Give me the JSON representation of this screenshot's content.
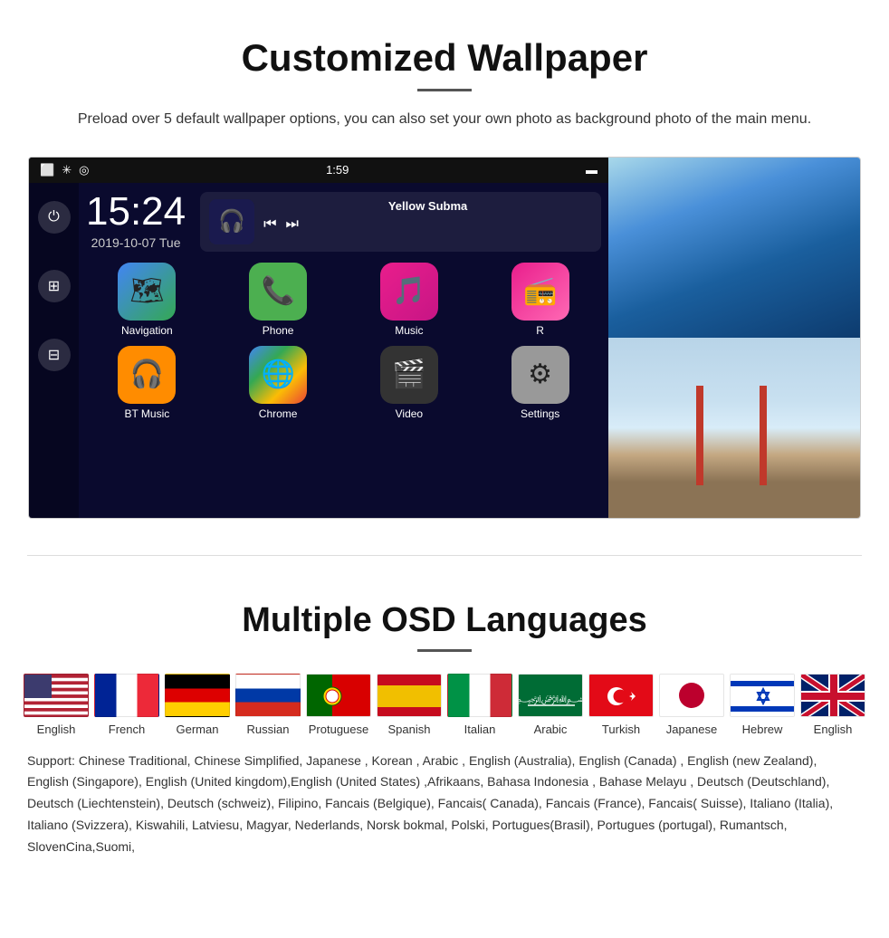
{
  "wallpaper_section": {
    "title": "Customized Wallpaper",
    "description": "Preload over 5 default wallpaper options, you can also set your own photo as background photo of the main menu.",
    "screen": {
      "time": "1:59",
      "clock": "15:24",
      "date": "2019-10-07  Tue",
      "music_title": "Yellow Subma",
      "apps": [
        {
          "label": "Navigation",
          "icon": "🗺"
        },
        {
          "label": "Phone",
          "icon": "📞"
        },
        {
          "label": "Music",
          "icon": "🎵"
        },
        {
          "label": "R",
          "icon": "📻"
        },
        {
          "label": "BT Music",
          "icon": "🎧"
        },
        {
          "label": "Chrome",
          "icon": "🌐"
        },
        {
          "label": "Video",
          "icon": "🎬"
        },
        {
          "label": "Settings",
          "icon": "⚙"
        }
      ]
    }
  },
  "languages_section": {
    "title": "Multiple OSD Languages",
    "flags": [
      {
        "code": "us",
        "label": "English"
      },
      {
        "code": "fr",
        "label": "French"
      },
      {
        "code": "de",
        "label": "German"
      },
      {
        "code": "ru",
        "label": "Russian"
      },
      {
        "code": "pt",
        "label": "Protuguese"
      },
      {
        "code": "es",
        "label": "Spanish"
      },
      {
        "code": "it",
        "label": "Italian"
      },
      {
        "code": "ar",
        "label": "Arabic"
      },
      {
        "code": "tr",
        "label": "Turkish"
      },
      {
        "code": "jp",
        "label": "Japanese"
      },
      {
        "code": "il",
        "label": "Hebrew"
      },
      {
        "code": "uk",
        "label": "English"
      }
    ],
    "support_text": "Support: Chinese Traditional, Chinese Simplified, Japanese , Korean , Arabic , English (Australia), English (Canada) , English (new Zealand), English (Singapore), English (United kingdom),English (United States) ,Afrikaans, Bahasa Indonesia , Bahase Melayu , Deutsch (Deutschland), Deutsch (Liechtenstein), Deutsch (schweiz), Filipino, Fancais (Belgique), Fancais( Canada), Fancais (France), Fancais( Suisse), Italiano (Italia), Italiano (Svizzera), Kiswahili, Latviesu, Magyar, Nederlands, Norsk bokmal, Polski, Portugues(Brasil), Portugues (portugal), Rumantsch, SlovenCina,Suomi,"
  }
}
